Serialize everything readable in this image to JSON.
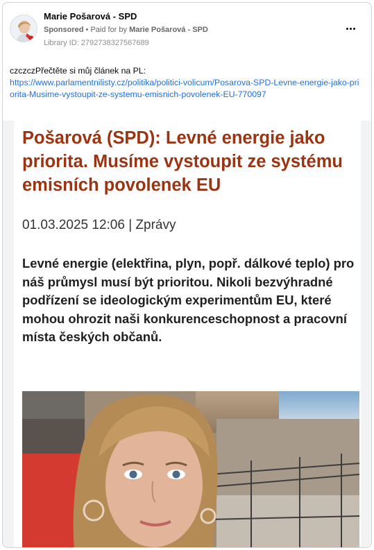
{
  "post": {
    "page_name": "Marie Pošarová - SPD",
    "sponsored_label": "Sponsored",
    "paid_for_prefix": "Paid for by",
    "paid_for_name": "Marie Pošarová - SPD",
    "library_id": "Library ID: 2792738327567689",
    "text_intro": "czczczPřečtěte si můj článek na PL:",
    "link_text": "https://www.parlamentnilisty.cz/politika/politici-volicum/Posarova-SPD-Levne-energie-jako-priorita-Musime-vystoupit-ze-systemu-emisnich-povolenek-EU-770097"
  },
  "article": {
    "headline": "Pošarová (SPD): Levné energie jako priorita. Musíme vystoupit ze systému emisních povolenek EU",
    "dateline": "01.03.2025 12:06 | Zprávy",
    "lead": "Levné energie (elektřina, plyn, popř. dálkové teplo) pro náš průmysl musí být prioritou. Nikoli bezvýhradné podřízení se ideologickým experimentům EU, které mohou ohrozit naši konkurenceschopnost a pracovní místa českých občanů."
  },
  "colors": {
    "headline": "#9a3412",
    "link": "#216fdb",
    "meta": "#65676b"
  },
  "icons": {
    "more": "more-horizontal-icon",
    "avatar": "profile-avatar"
  }
}
